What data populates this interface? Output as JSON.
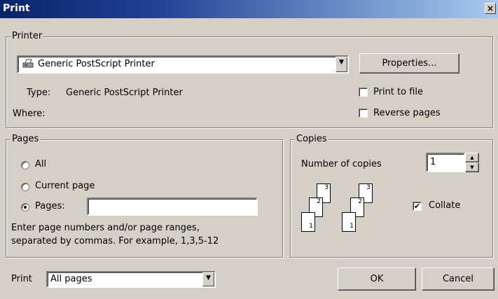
{
  "window": {
    "title": "Print",
    "close_glyph": "×"
  },
  "printer": {
    "group_label": "Printer",
    "selected": "Generic PostScript Printer",
    "properties_label": "Properties...",
    "type_label": "Type:",
    "type_value": "Generic PostScript Printer",
    "where_label": "Where:",
    "print_to_file": {
      "label": "Print to file",
      "checked": false
    },
    "reverse_pages": {
      "label": "Reverse pages",
      "checked": false
    }
  },
  "pages": {
    "group_label": "Pages",
    "all_label": "All",
    "current_label": "Current page",
    "pages_label": "Pages:",
    "pages_value": "",
    "selected": "pages",
    "hint_line1": "Enter page numbers and/or page ranges,",
    "hint_line2": "separated by commas. For example, 1,3,5-12"
  },
  "copies": {
    "group_label": "Copies",
    "number_label": "Number of copies",
    "number_value": "1",
    "collate": {
      "label": "Collate",
      "checked": true
    },
    "stack_numbers": [
      "1",
      "2",
      "3"
    ]
  },
  "footer": {
    "print_label": "Print",
    "print_value": "All pages",
    "ok_label": "OK",
    "cancel_label": "Cancel"
  }
}
